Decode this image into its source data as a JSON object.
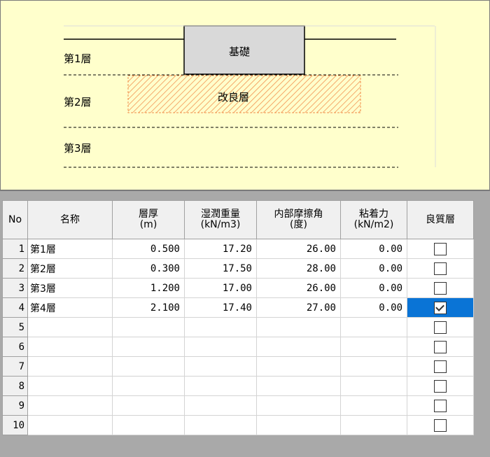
{
  "diagram": {
    "foundation_label": "基礎",
    "improved_label": "改良層",
    "layer_labels": [
      "第1層",
      "第2層",
      "第3層"
    ]
  },
  "table": {
    "headers": [
      "No",
      "名称",
      "層厚\n(m)",
      "湿潤重量\n(kN/m3)",
      "内部摩擦角\n(度)",
      "粘着力\n(kN/m2)",
      "良質層"
    ],
    "rows": [
      {
        "no": "1",
        "name": "第1層",
        "thickness": "0.500",
        "unit_weight": "17.20",
        "friction": "26.00",
        "cohesion": "0.00",
        "good": false
      },
      {
        "no": "2",
        "name": "第2層",
        "thickness": "0.300",
        "unit_weight": "17.50",
        "friction": "28.00",
        "cohesion": "0.00",
        "good": false
      },
      {
        "no": "3",
        "name": "第3層",
        "thickness": "1.200",
        "unit_weight": "17.00",
        "friction": "26.00",
        "cohesion": "0.00",
        "good": false
      },
      {
        "no": "4",
        "name": "第4層",
        "thickness": "2.100",
        "unit_weight": "17.40",
        "friction": "27.00",
        "cohesion": "0.00",
        "good": true
      },
      {
        "no": "5",
        "name": "",
        "thickness": "",
        "unit_weight": "",
        "friction": "",
        "cohesion": "",
        "good": false
      },
      {
        "no": "6",
        "name": "",
        "thickness": "",
        "unit_weight": "",
        "friction": "",
        "cohesion": "",
        "good": false
      },
      {
        "no": "7",
        "name": "",
        "thickness": "",
        "unit_weight": "",
        "friction": "",
        "cohesion": "",
        "good": false
      },
      {
        "no": "8",
        "name": "",
        "thickness": "",
        "unit_weight": "",
        "friction": "",
        "cohesion": "",
        "good": false
      },
      {
        "no": "9",
        "name": "",
        "thickness": "",
        "unit_weight": "",
        "friction": "",
        "cohesion": "",
        "good": false
      },
      {
        "no": "10",
        "name": "",
        "thickness": "",
        "unit_weight": "",
        "friction": "",
        "cohesion": "",
        "good": false
      }
    ],
    "selected_row": 3
  }
}
